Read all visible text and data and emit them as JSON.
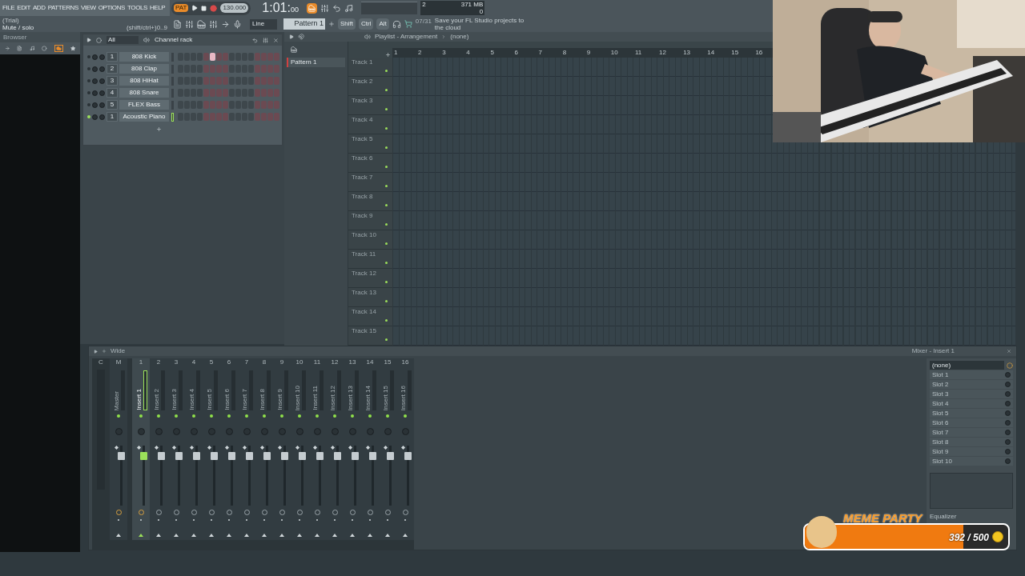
{
  "menu": [
    "FILE",
    "EDIT",
    "ADD",
    "PATTERNS",
    "VIEW",
    "OPTIONS",
    "TOOLS",
    "HELP"
  ],
  "hint": {
    "title": "(Trial)",
    "text": "Mute / solo",
    "shortcut": "(shift/ctrl+)0..9"
  },
  "transport": {
    "mode": "PAT",
    "tempo": "130.000",
    "time": "1:01:",
    "time_sub": "00"
  },
  "snap": "Line",
  "pattern": "Pattern 1",
  "modifiers": [
    "Shift",
    "Ctrl",
    "Alt"
  ],
  "news": {
    "date": "07/31",
    "text": "Save your FL Studio projects to the cloud"
  },
  "monitor": {
    "cpu": "2",
    "memory": "371 MB",
    "polyphony": "0"
  },
  "browser": {
    "title": "Browser"
  },
  "channel_rack": {
    "title": "Channel rack",
    "filter": "All",
    "channels": [
      {
        "name": "808 Kick",
        "route": "1",
        "selected": false,
        "steps": [
          false,
          false,
          false,
          false,
          false,
          true,
          false,
          false,
          false,
          false,
          false,
          false,
          false,
          false,
          false,
          false
        ]
      },
      {
        "name": "808 Clap",
        "route": "2",
        "selected": false,
        "steps": [
          false,
          false,
          false,
          false,
          false,
          false,
          false,
          false,
          false,
          false,
          false,
          false,
          false,
          false,
          false,
          false
        ]
      },
      {
        "name": "808 HiHat",
        "route": "3",
        "selected": false,
        "steps": [
          false,
          false,
          false,
          false,
          false,
          false,
          false,
          false,
          false,
          false,
          false,
          false,
          false,
          false,
          false,
          false
        ]
      },
      {
        "name": "808 Snare",
        "route": "4",
        "selected": false,
        "steps": [
          false,
          false,
          false,
          false,
          false,
          false,
          false,
          false,
          false,
          false,
          false,
          false,
          false,
          false,
          false,
          false
        ]
      },
      {
        "name": "FLEX Bass",
        "route": "5",
        "selected": false,
        "steps": [
          false,
          false,
          false,
          false,
          false,
          false,
          false,
          false,
          false,
          false,
          false,
          false,
          false,
          false,
          false,
          false
        ]
      },
      {
        "name": "Acoustic Piano",
        "route": "1",
        "selected": true,
        "steps": [
          false,
          false,
          false,
          false,
          false,
          false,
          false,
          false,
          false,
          false,
          false,
          false,
          false,
          false,
          false,
          false
        ]
      }
    ]
  },
  "playlist": {
    "title": "Playlist - Arrangement",
    "arrangement": "(none)",
    "patterns": [
      {
        "name": "Pattern 1"
      }
    ],
    "ruler": [
      "1",
      "2",
      "3",
      "4",
      "5",
      "6",
      "7",
      "8",
      "9",
      "10",
      "11",
      "12",
      "13",
      "14",
      "15",
      "16"
    ],
    "tracks": [
      "Track 1",
      "Track 2",
      "Track 3",
      "Track 4",
      "Track 5",
      "Track 6",
      "Track 7",
      "Track 8",
      "Track 9",
      "Track 10",
      "Track 11",
      "Track 12",
      "Track 13",
      "Track 14",
      "Track 15"
    ]
  },
  "mixer": {
    "mode": "Wide",
    "headers": [
      "C"
    ],
    "strips": [
      {
        "number": "M",
        "name": "Master",
        "selected": false
      },
      {
        "number": "1",
        "name": "Insert 1",
        "selected": true
      },
      {
        "number": "2",
        "name": "Insert 2",
        "selected": false
      },
      {
        "number": "3",
        "name": "Insert 3",
        "selected": false
      },
      {
        "number": "4",
        "name": "Insert 4",
        "selected": false
      },
      {
        "number": "5",
        "name": "Insert 5",
        "selected": false
      },
      {
        "number": "6",
        "name": "Insert 6",
        "selected": false
      },
      {
        "number": "7",
        "name": "Insert 7",
        "selected": false
      },
      {
        "number": "8",
        "name": "Insert 8",
        "selected": false
      },
      {
        "number": "9",
        "name": "Insert 9",
        "selected": false
      },
      {
        "number": "10",
        "name": "Insert 10",
        "selected": false
      },
      {
        "number": "11",
        "name": "Insert 11",
        "selected": false
      },
      {
        "number": "12",
        "name": "Insert 12",
        "selected": false
      },
      {
        "number": "13",
        "name": "Insert 13",
        "selected": false
      },
      {
        "number": "14",
        "name": "Insert 14",
        "selected": false
      },
      {
        "number": "15",
        "name": "Insert 15",
        "selected": false
      },
      {
        "number": "16",
        "name": "Insert 16",
        "selected": false
      }
    ],
    "panel": {
      "title": "Mixer - Insert 1",
      "input": "(none)",
      "slots": [
        "Slot 1",
        "Slot 2",
        "Slot 3",
        "Slot 4",
        "Slot 5",
        "Slot 6",
        "Slot 7",
        "Slot 8",
        "Slot 9",
        "Slot 10"
      ],
      "equalizer": "Equalizer"
    }
  },
  "goal": {
    "title": "MEME PARTY",
    "count": "392 / 500",
    "level": 0.78
  }
}
